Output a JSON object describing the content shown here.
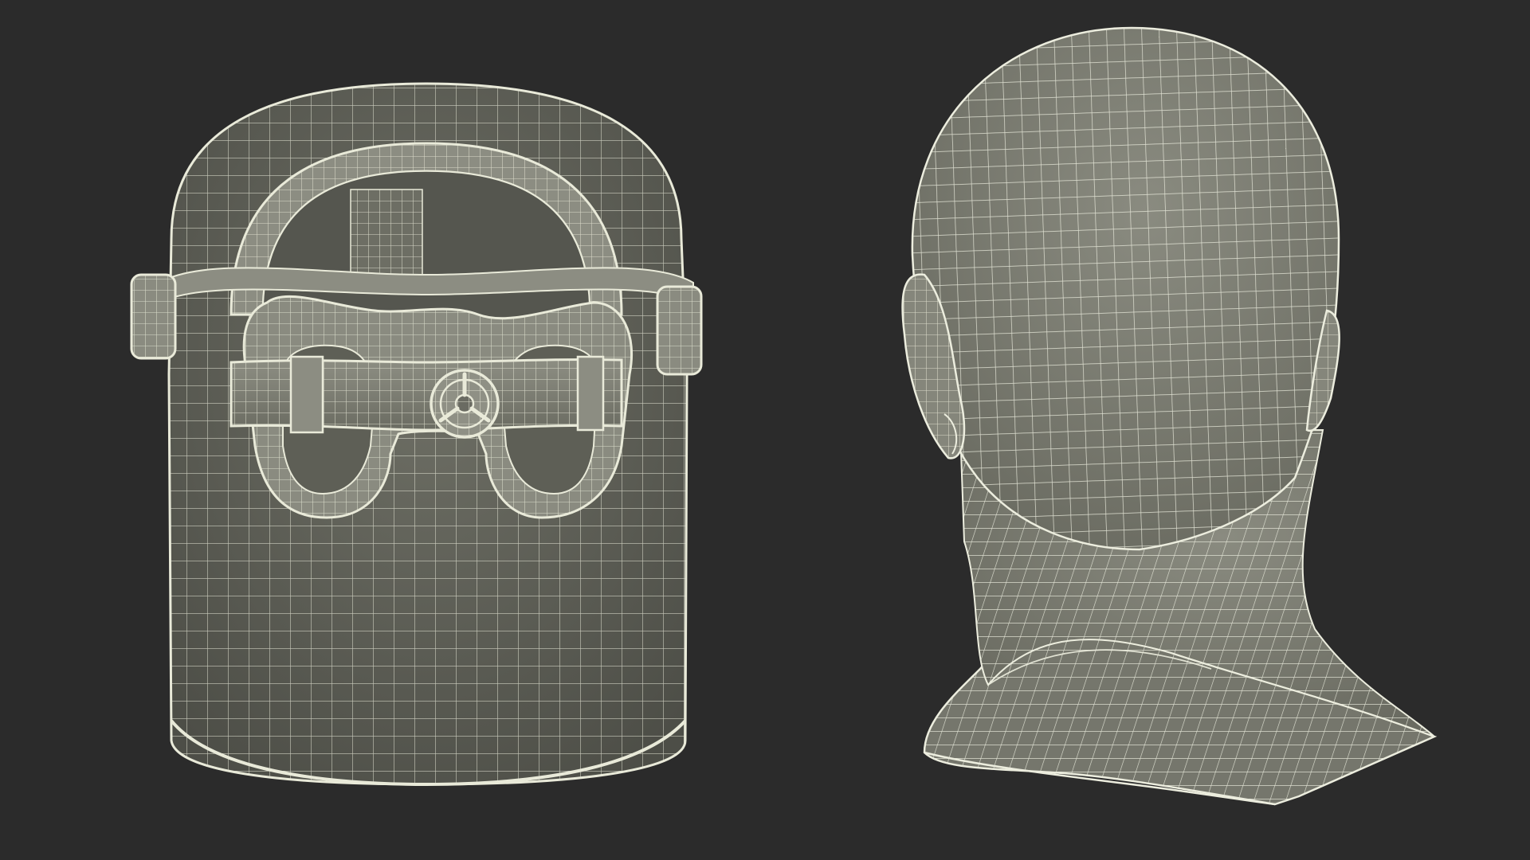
{
  "scene": {
    "background_color": "#2b2b2b",
    "surface_color": "#7d7e72",
    "surface_dark_color": "#5e5f56",
    "wire_color": "#e9ead9",
    "objects": [
      {
        "name": "face-shield-with-goggles",
        "view": "back"
      },
      {
        "name": "mannequin-head",
        "view": "back"
      }
    ]
  }
}
